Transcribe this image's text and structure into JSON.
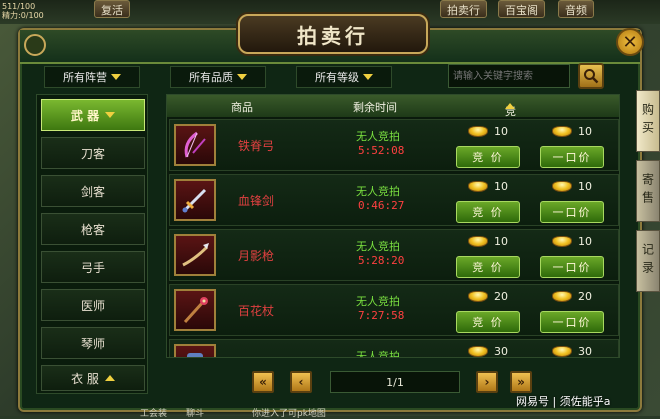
{
  "topbar": {
    "hp_line": "511/100",
    "mp_line": "精力:0/100",
    "buttons": [
      "复活",
      "拍卖行",
      "百宝阁",
      "音频"
    ]
  },
  "window": {
    "title": "拍卖行",
    "close_label": "✕"
  },
  "filters": {
    "faction": "所有阵营",
    "quality": "所有品质",
    "level": "所有等级"
  },
  "search": {
    "placeholder": "请输入关键字搜索"
  },
  "categories": [
    {
      "label": "武 器",
      "active": true
    },
    {
      "label": "刀客"
    },
    {
      "label": "剑客"
    },
    {
      "label": "枪客"
    },
    {
      "label": "弓手"
    },
    {
      "label": "医师"
    },
    {
      "label": "琴师"
    },
    {
      "label": "衣 服"
    }
  ],
  "table": {
    "col_item": "商品",
    "col_time": "剩余时间",
    "col_price": "竞拍价格",
    "rows": [
      {
        "name": "铁脊弓",
        "status": "无人竞拍",
        "time": "5:52:08",
        "bid_price": "10",
        "buyout_price": "10",
        "bid_label": "竞 价",
        "buyout_label": "一口价",
        "icon": "bow-icon"
      },
      {
        "name": "血锋剑",
        "status": "无人竞拍",
        "time": "0:46:27",
        "bid_price": "10",
        "buyout_price": "10",
        "bid_label": "竞 价",
        "buyout_label": "一口价",
        "icon": "sword-icon"
      },
      {
        "name": "月影枪",
        "status": "无人竞拍",
        "time": "5:28:20",
        "bid_price": "10",
        "buyout_price": "10",
        "bid_label": "竞 价",
        "buyout_label": "一口价",
        "icon": "spear-icon"
      },
      {
        "name": "百花杖",
        "status": "无人竞拍",
        "time": "7:27:58",
        "bid_price": "20",
        "buyout_price": "20",
        "bid_label": "竞 价",
        "buyout_label": "一口价",
        "icon": "staff-icon"
      },
      {
        "name": "",
        "status": "无人竞拍",
        "time": "",
        "bid_price": "30",
        "buyout_price": "30",
        "bid_label": "",
        "buyout_label": "",
        "icon": "item-icon"
      }
    ]
  },
  "pager": {
    "page_text": "1/1"
  },
  "side_tabs": [
    "购买",
    "寄售",
    "记录"
  ],
  "watermark": "网易号 | 须佐能乎a",
  "bottom": {
    "left": "工会装",
    "mid": "聊斗",
    "right": "你进入了可pk地图"
  },
  "colors": {
    "accent_green": "#6aa828",
    "gold": "#f0c020",
    "item_name_red": "#e04040",
    "status_green": "#7ae040"
  }
}
